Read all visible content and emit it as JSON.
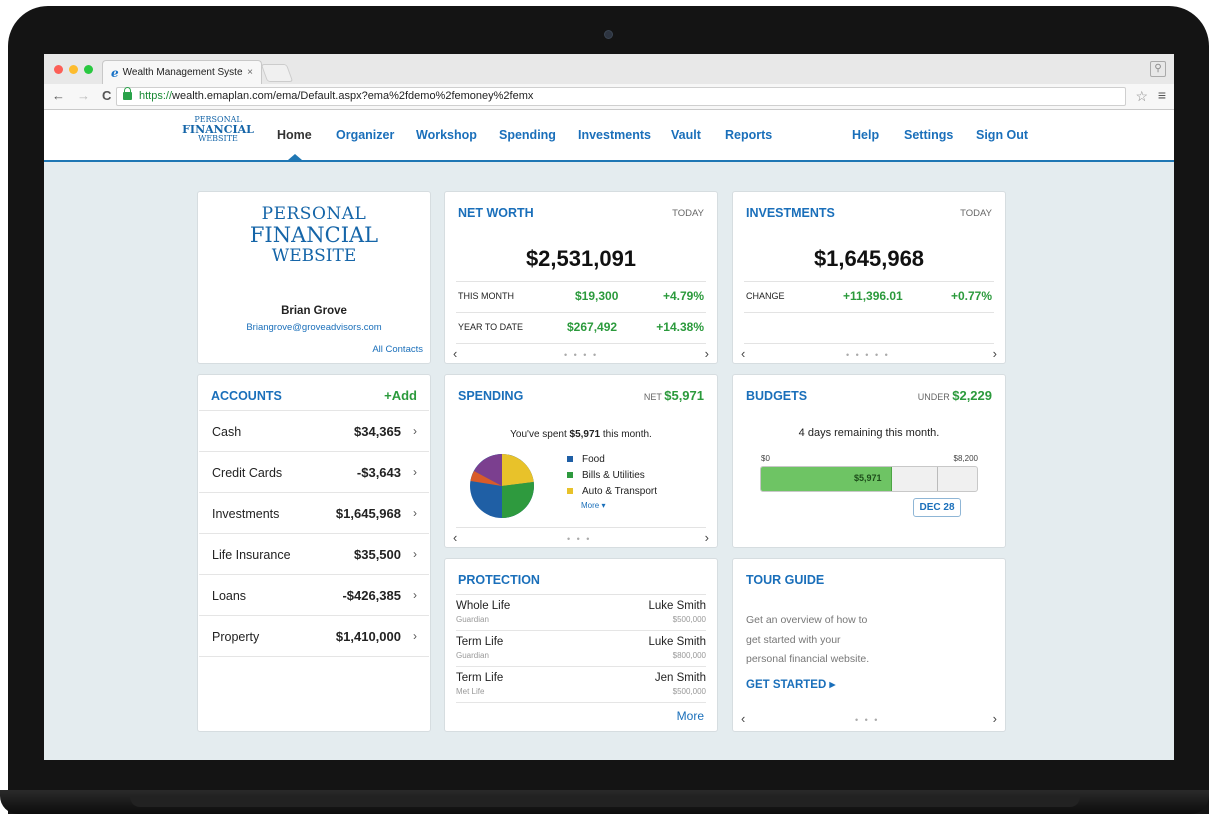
{
  "browser": {
    "tab_title": "Wealth Management Syste",
    "tab_close": "×",
    "url_https": "https://",
    "url_rest": "wealth.emaplan.com/ema/Default.aspx?ema%2fdemo%2femoney%2femx",
    "back": "←",
    "forward": "→",
    "reload": "C"
  },
  "site": {
    "logo": {
      "l1": "Personal",
      "l2": "Financial",
      "l3": "Website"
    },
    "nav": [
      "Home",
      "Organizer",
      "Workshop",
      "Spending",
      "Investments",
      "Vault",
      "Reports",
      "Help",
      "Settings",
      "Sign Out"
    ]
  },
  "profile": {
    "logo": {
      "l1": "Personal",
      "l2": "Financial",
      "l3": "Website"
    },
    "name": "Brian Grove",
    "email": "Briangrove@groveadvisors.com",
    "contacts_link": "All Contacts"
  },
  "net_worth": {
    "title": "NET WORTH",
    "period": "TODAY",
    "value": "$2,531,091",
    "rows": [
      {
        "label": "THIS MONTH",
        "amount": "$19,300",
        "pct": "+4.79%"
      },
      {
        "label": "YEAR TO DATE",
        "amount": "$267,492",
        "pct": "+14.38%"
      }
    ],
    "prev": "‹",
    "next": "›",
    "dots": "• • • •"
  },
  "investments": {
    "title": "INVESTMENTS",
    "period": "TODAY",
    "value": "$1,645,968",
    "change_label": "CHANGE",
    "change_amount": "+11,396.01",
    "change_pct": "+0.77%",
    "prev": "‹",
    "next": "›",
    "dots": "• • • • •"
  },
  "accounts": {
    "title": "ACCOUNTS",
    "add": "+Add",
    "rows": [
      {
        "name": "Cash",
        "value": "$34,365"
      },
      {
        "name": "Credit Cards",
        "value": "-$3,643"
      },
      {
        "name": "Investments",
        "value": "$1,645,968"
      },
      {
        "name": "Life Insurance",
        "value": "$35,500"
      },
      {
        "name": "Loans",
        "value": "-$426,385"
      },
      {
        "name": "Property",
        "value": "$1,410,000"
      }
    ],
    "chevron": "›"
  },
  "spending": {
    "title": "SPENDING",
    "net_label": "NET",
    "net_value": "$5,971",
    "summary_pre": "You've spent ",
    "summary_amount": "$5,971",
    "summary_post": " this month.",
    "legend": [
      {
        "label": "Food",
        "color": "#1f5fa5"
      },
      {
        "label": "Bills & Utilities",
        "color": "#2e9a3e"
      },
      {
        "label": "Auto & Transport",
        "color": "#e8c22a"
      }
    ],
    "more": "More ▾",
    "pie_colors": [
      "#1f5fa5",
      "#2e9a3e",
      "#e8c22a",
      "#7b3f8f",
      "#d95b2a",
      "#3a86c8"
    ],
    "prev": "‹",
    "next": "›",
    "dots": "• • •"
  },
  "budgets": {
    "title": "BUDGETS",
    "under_label": "UNDER",
    "under_value": "$2,229",
    "remaining": "4 days remaining this month.",
    "min": "$0",
    "max": "$8,200",
    "spent": "$5,971",
    "spent_fraction": 0.6,
    "date_marker": "DEC 28"
  },
  "protection": {
    "title": "PROTECTION",
    "rows": [
      {
        "type": "Whole Life",
        "carrier": "Guardian",
        "name": "Luke Smith",
        "amount": "$500,000"
      },
      {
        "type": "Term Life",
        "carrier": "Guardian",
        "name": "Luke Smith",
        "amount": "$800,000"
      },
      {
        "type": "Term Life",
        "carrier": "Met Life",
        "name": "Jen Smith",
        "amount": "$500,000"
      }
    ],
    "more": "More"
  },
  "tour": {
    "title": "TOUR GUIDE",
    "line1": "Get an overview of how to",
    "line2": "get started with your",
    "line3": "personal financial website.",
    "cta": "GET STARTED ▸",
    "prev": "‹",
    "next": "›",
    "dots": "• • •"
  }
}
